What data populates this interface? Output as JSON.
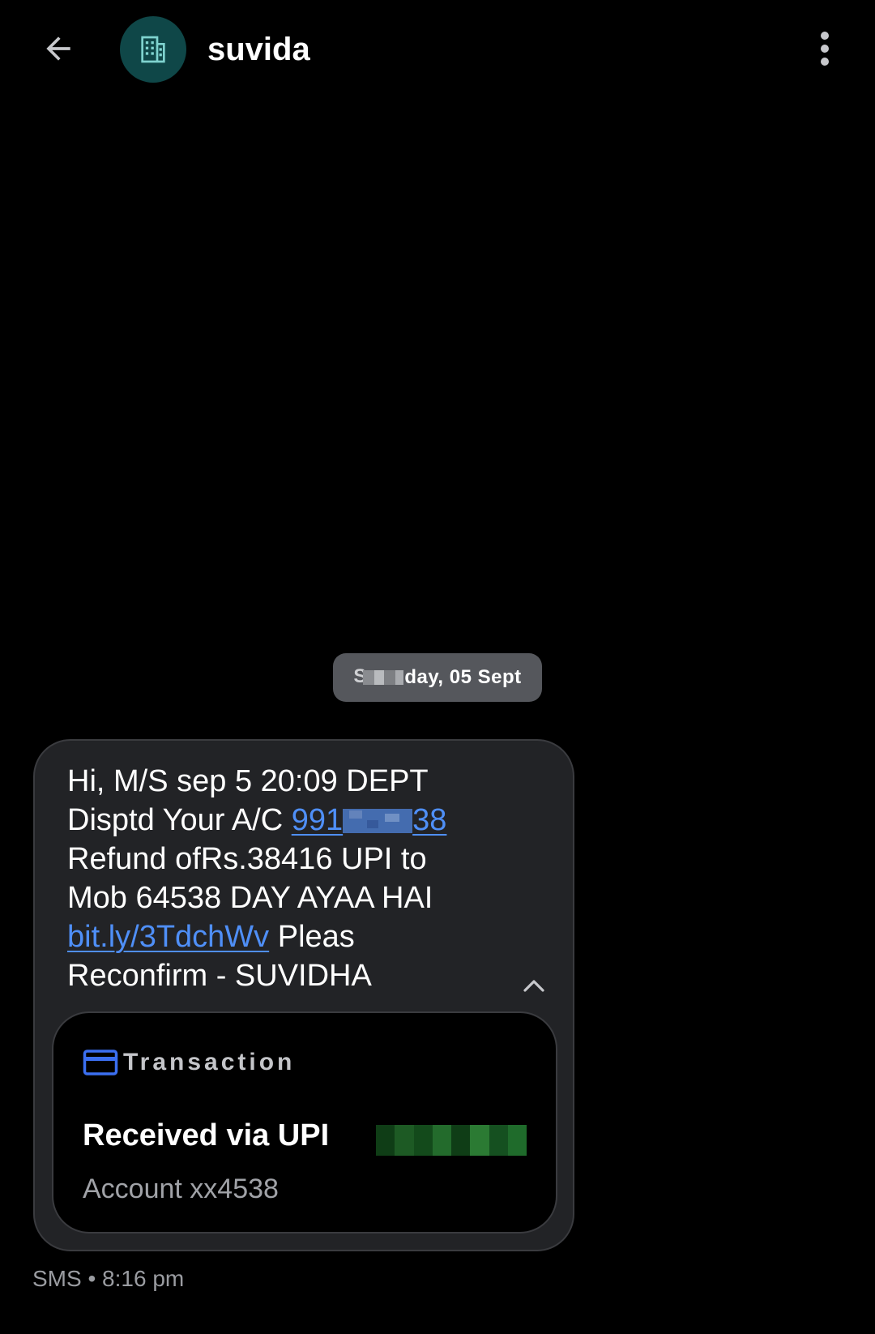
{
  "header": {
    "contact_name": "suvida",
    "back_icon": "arrow-left-icon",
    "avatar_icon": "business-building-icon",
    "menu_icon": "more-vert-icon",
    "avatar_color": "#0f4748",
    "avatar_icon_color": "#7fd3cf"
  },
  "date_chip": {
    "first_letter": "S",
    "label_tail": "day, 05 Sept"
  },
  "message": {
    "line1": "Hi, M/S sep 5 20:09 DEPT",
    "line2_prefix": "Disptd Your A/C ",
    "account_link_start": "991",
    "account_link_end": "38",
    "line3": "Refund ofRs.38416 UPI to",
    "line4": "Mob 64538 DAY AYAA HAI",
    "short_link": "bit.ly/3TdchWv",
    "line5_suffix": " Pleas",
    "line6": "Reconfirm - SUVIDHA",
    "collapse_icon": "chevron-up-icon",
    "link_color": "#4f8ff7"
  },
  "transaction": {
    "icon": "credit-card-icon",
    "icon_color": "#3b6ff0",
    "title": "Transaction",
    "main_label": "Received via UPI",
    "account": "Account xx4538",
    "amount_color": "#1f6b2b"
  },
  "meta": {
    "text": "SMS • 8:16 pm"
  }
}
